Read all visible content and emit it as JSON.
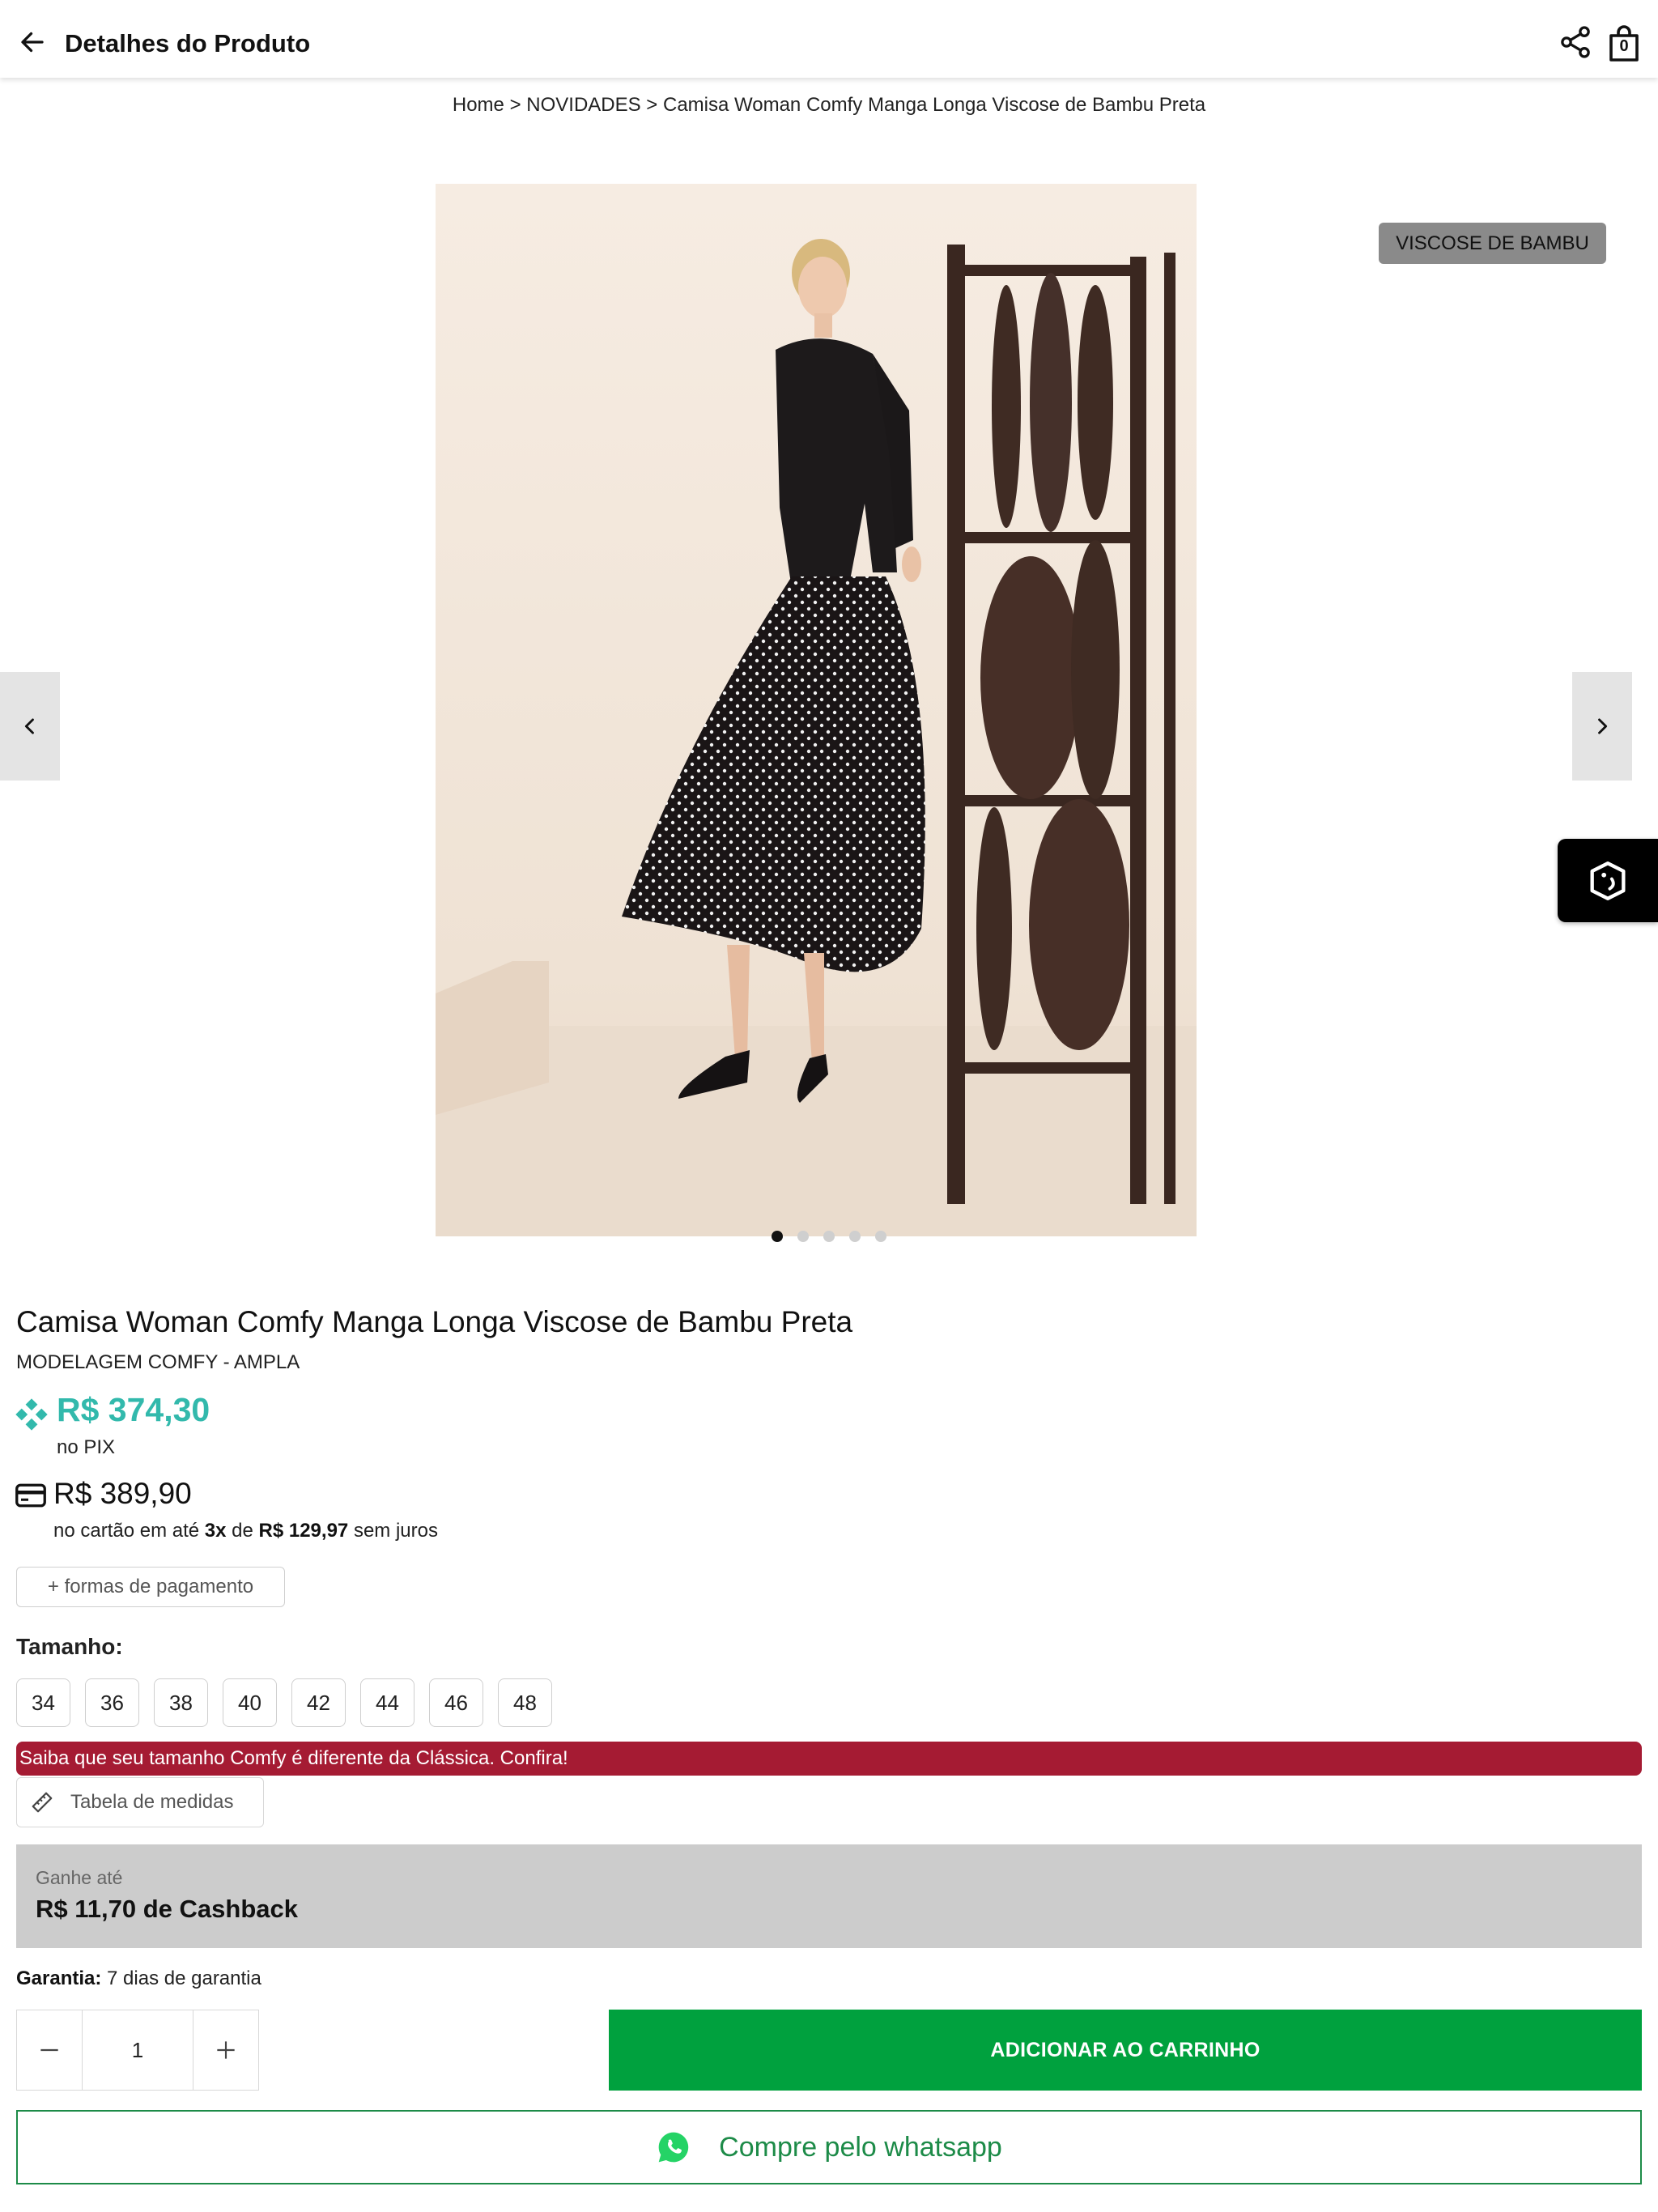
{
  "header": {
    "title": "Detalhes do Produto",
    "back_icon": "arrow-left-icon",
    "share_icon": "share-icon",
    "bag_icon": "shopping-bag-icon",
    "bag_count": "0"
  },
  "breadcrumb": {
    "items": [
      "Home",
      "NOVIDADES",
      "Camisa Woman Comfy Manga Longa Viscose de Bambu Preta"
    ],
    "separator": " > "
  },
  "gallery": {
    "badge": "VISCOSE DE BAMBU",
    "dots_count": 5,
    "active_dot": 0
  },
  "product": {
    "title": "Camisa Woman Comfy Manga Longa Viscose de Bambu Preta",
    "subtitle": "MODELAGEM COMFY - AMPLA",
    "pix_price": "R$ 374,30",
    "pix_label": "no PIX",
    "card_price": "R$ 389,90",
    "installments_prefix": "no cartão em até ",
    "installments_count": "3x",
    "installments_mid": " de ",
    "installments_value": "R$ 129,97",
    "installments_suffix": " sem juros",
    "payment_button": "+ formas de pagamento"
  },
  "sizes": {
    "label": "Tamanho:",
    "options": [
      "34",
      "36",
      "38",
      "40",
      "42",
      "44",
      "46",
      "48"
    ],
    "alert": "Saiba que seu tamanho Comfy é diferente da Clássica. Confira!",
    "measure_button": "Tabela de medidas"
  },
  "cashback": {
    "small": "Ganhe até",
    "big": "R$ 11,70 de Cashback"
  },
  "warranty": {
    "label": "Garantia:",
    "value": " 7 dias de garantia"
  },
  "purchase": {
    "quantity": "1",
    "add_to_cart": "ADICIONAR AO CARRINHO",
    "whatsapp": "Compre pelo whatsapp"
  },
  "colors": {
    "pix_accent": "#32b9ac",
    "alert_red": "#a51b33",
    "cart_green": "#00a13e",
    "whatsapp_green": "#1d8b48"
  }
}
